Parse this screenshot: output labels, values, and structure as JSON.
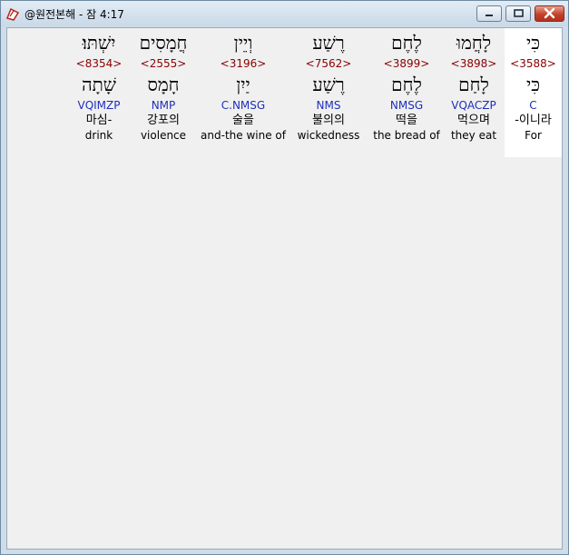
{
  "window": {
    "title": "@원전본해 - 잠 4:17"
  },
  "verse": {
    "words": [
      {
        "hebrew": "כִּי",
        "strong": "<3588>",
        "lemma": "כִּי",
        "morph": "C",
        "korean": "-이니라",
        "english": "For",
        "active": true,
        "width": 63
      },
      {
        "hebrew": "לָחֲמוּ",
        "strong": "<3898>",
        "lemma": "לָחַם",
        "morph": "VQACZP",
        "korean": "먹으며",
        "english": "they eat",
        "active": false,
        "width": 68
      },
      {
        "hebrew": "לֶחֶם",
        "strong": "<3899>",
        "lemma": "לֶחֶם",
        "morph": "NMSG",
        "korean": "떡을",
        "english": "the bread of",
        "active": false,
        "width": 80
      },
      {
        "hebrew": "רֶשַׁע",
        "strong": "<7562>",
        "lemma": "רֶשַׁע",
        "morph": "NMS",
        "korean": "불의의",
        "english": "wickedness",
        "active": false,
        "width": 92
      },
      {
        "hebrew": "וְיֵין",
        "strong": "<3196>",
        "lemma": "יַיִן",
        "morph": "C.NMSG",
        "korean": "술을",
        "english": "and-the wine of",
        "active": false,
        "width": 96
      },
      {
        "hebrew": "חֲמָסִים",
        "strong": "<2555>",
        "lemma": "חָמָס",
        "morph": "NMP",
        "korean": "강포의",
        "english": "violence",
        "active": false,
        "width": 80
      },
      {
        "hebrew": "יִשְׁתּוּ׃",
        "strong": "<8354>",
        "lemma": "שָׁתָה",
        "morph": "VQIMZP",
        "korean": "마심-",
        "english": "drink",
        "active": false,
        "width": 62
      }
    ]
  }
}
